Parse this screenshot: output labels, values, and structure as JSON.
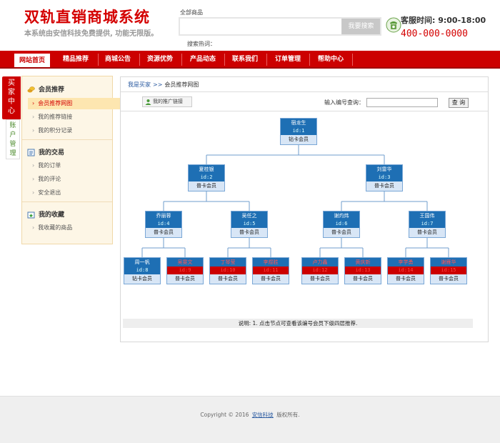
{
  "header": {
    "site_title": "双轨直销商城系统",
    "site_subtitle": "本系统由安信科技免费提供, 功能无限版。",
    "search_category": "全部商品",
    "search_placeholder": "",
    "search_button": "我要搜索",
    "hot_search_label": "搜索热词：",
    "service_time": "客服时间: 9:00-18:00",
    "service_phone": "400-000-0000"
  },
  "nav": [
    {
      "label": "网站首页",
      "active": true
    },
    {
      "label": "精品推荐"
    },
    {
      "label": "商城公告"
    },
    {
      "label": "资源优势"
    },
    {
      "label": "产品动态"
    },
    {
      "label": "联系我们"
    },
    {
      "label": "订单管理"
    },
    {
      "label": "帮助中心"
    }
  ],
  "sidebar": {
    "tab_buyer": "买家中心",
    "tab_account": "账户管理",
    "groups": [
      {
        "title": "会员推荐",
        "icon": "coins-icon",
        "items": [
          "会员推荐网图",
          "我的推荐链接",
          "我的积分记录"
        ]
      },
      {
        "title": "我的交易",
        "icon": "document-icon",
        "items": [
          "我的订单",
          "我的评论",
          "安全退出"
        ]
      },
      {
        "title": "我的收藏",
        "icon": "star-folder-icon",
        "items": [
          "我收藏的商品"
        ]
      }
    ],
    "active_item": "会员推荐网图"
  },
  "main": {
    "breadcrumb_root": "我是买家",
    "breadcrumb_sep": ">>",
    "breadcrumb_current": "会员推荐网图",
    "promo_link_button": "我的推广链接",
    "lookup_label": "输入编号查询：",
    "lookup_value": "",
    "lookup_button": "查 询",
    "note": "说明: 1. 点击节点可查看该编号会员下级四层推荐."
  },
  "tree": {
    "nodes": [
      {
        "name": "宿龙生",
        "id": "id:1",
        "level": "钻卡会员"
      },
      {
        "name": "夏桂银",
        "id": "id:2",
        "level": "普卡会员"
      },
      {
        "name": "刘雷华",
        "id": "id:3",
        "level": "普卡会员"
      },
      {
        "name": "乔丽蓉",
        "id": "id:4",
        "level": "普卡会员"
      },
      {
        "name": "吴任之",
        "id": "id:5",
        "level": "普卡会员"
      },
      {
        "name": "谢灼炜",
        "id": "id:6",
        "level": "普卡会员"
      },
      {
        "name": "王国伟",
        "id": "id:7",
        "level": "普卡会员"
      },
      {
        "name": "周一帆",
        "id": "id:8",
        "level": "钻卡会员",
        "color": "blue"
      },
      {
        "name": "吴雯文",
        "id": "id:9",
        "level": "普卡会员",
        "color": "red"
      },
      {
        "name": "丁琴莹",
        "id": "id:10",
        "level": "普卡会员",
        "color": "red"
      },
      {
        "name": "李煜胜",
        "id": "id:11",
        "level": "普卡会员",
        "color": "red"
      },
      {
        "name": "卢力鑫",
        "id": "id:12",
        "level": "普卡会员",
        "color": "red"
      },
      {
        "name": "黄庆新",
        "id": "id:13",
        "level": "普卡会员",
        "color": "red"
      },
      {
        "name": "李学勇",
        "id": "id:14",
        "level": "普卡会员",
        "color": "red"
      },
      {
        "name": "谢雁华",
        "id": "id:15",
        "level": "普卡会员",
        "color": "red"
      }
    ]
  },
  "footer": {
    "copy_prefix": "Copyright © 2016",
    "company": "安信科技",
    "copy_suffix": "版权所有."
  }
}
